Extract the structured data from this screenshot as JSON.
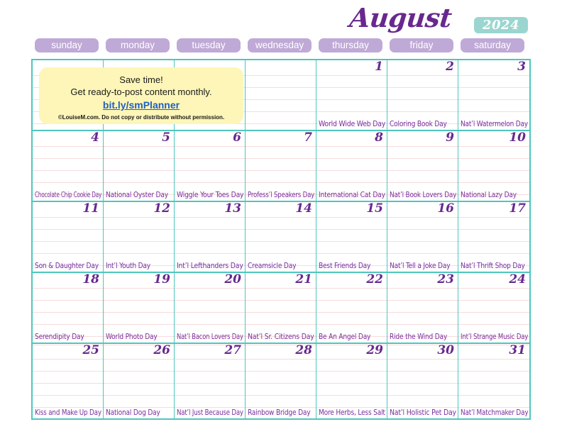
{
  "header": {
    "month": "August",
    "year": "2024"
  },
  "weekdays": [
    "sunday",
    "monday",
    "tuesday",
    "wednesday",
    "thursday",
    "friday",
    "saturday"
  ],
  "promo": {
    "line1": "Save time!",
    "line2": "Get ready-to-post content monthly.",
    "link": "bit.ly/smPlanner",
    "copyright": "©LouiseM.com. Do not copy or distribute without permission."
  },
  "colors": {
    "title_purple": "#68288f",
    "year_badge_teal": "#9ad6cf",
    "weekday_pill_purple": "#bfa9d6",
    "grid_border_teal": "#4ec6bd",
    "rule_line_pink": "#f6dcdc",
    "event_text_purple": "#7b2d9e",
    "note_yellow": "#fdf6b8",
    "link_blue": "#2060c0"
  },
  "weeks": [
    [
      {
        "date": "",
        "event": ""
      },
      {
        "date": "",
        "event": ""
      },
      {
        "date": "",
        "event": ""
      },
      {
        "date": "",
        "event": ""
      },
      {
        "date": "1",
        "event": "World Wide Web Day"
      },
      {
        "date": "2",
        "event": "Coloring Book Day"
      },
      {
        "date": "3",
        "event": "Nat’l Watermelon Day"
      }
    ],
    [
      {
        "date": "4",
        "event": "Chocolate Chip Cookie Day"
      },
      {
        "date": "5",
        "event": "National Oyster Day"
      },
      {
        "date": "6",
        "event": "Wiggle Your Toes Day"
      },
      {
        "date": "7",
        "event": "Profess’l Speakers Day"
      },
      {
        "date": "8",
        "event": "International Cat Day"
      },
      {
        "date": "9",
        "event": "Nat’l Book Lovers Day"
      },
      {
        "date": "10",
        "event": "National Lazy Day"
      }
    ],
    [
      {
        "date": "11",
        "event": "Son & Daughter Day"
      },
      {
        "date": "12",
        "event": "Int’l Youth Day"
      },
      {
        "date": "13",
        "event": "Int’l Lefthanders Day"
      },
      {
        "date": "14",
        "event": "Creamsicle Day"
      },
      {
        "date": "15",
        "event": "Best Friends Day"
      },
      {
        "date": "16",
        "event": "Nat’l Tell a Joke Day"
      },
      {
        "date": "17",
        "event": "Nat’l Thrift Shop Day"
      }
    ],
    [
      {
        "date": "18",
        "event": "Serendipity Day"
      },
      {
        "date": "19",
        "event": "World Photo Day"
      },
      {
        "date": "20",
        "event": "Nat’l Bacon Lovers Day"
      },
      {
        "date": "21",
        "event": "Nat’l Sr. Citizens Day"
      },
      {
        "date": "22",
        "event": "Be An Angel Day"
      },
      {
        "date": "23",
        "event": "Ride the Wind Day"
      },
      {
        "date": "24",
        "event": "Int’l Strange Music Day"
      }
    ],
    [
      {
        "date": "25",
        "event": "Kiss and Make Up Day"
      },
      {
        "date": "26",
        "event": "National Dog Day"
      },
      {
        "date": "27",
        "event": "Nat’l Just Because Day"
      },
      {
        "date": "28",
        "event": "Rainbow Bridge Day"
      },
      {
        "date": "29",
        "event": "More Herbs, Less Salt"
      },
      {
        "date": "30",
        "event": "Nat’l Holistic Pet Day"
      },
      {
        "date": "31",
        "event": "Nat’l Matchmaker Day"
      }
    ]
  ]
}
